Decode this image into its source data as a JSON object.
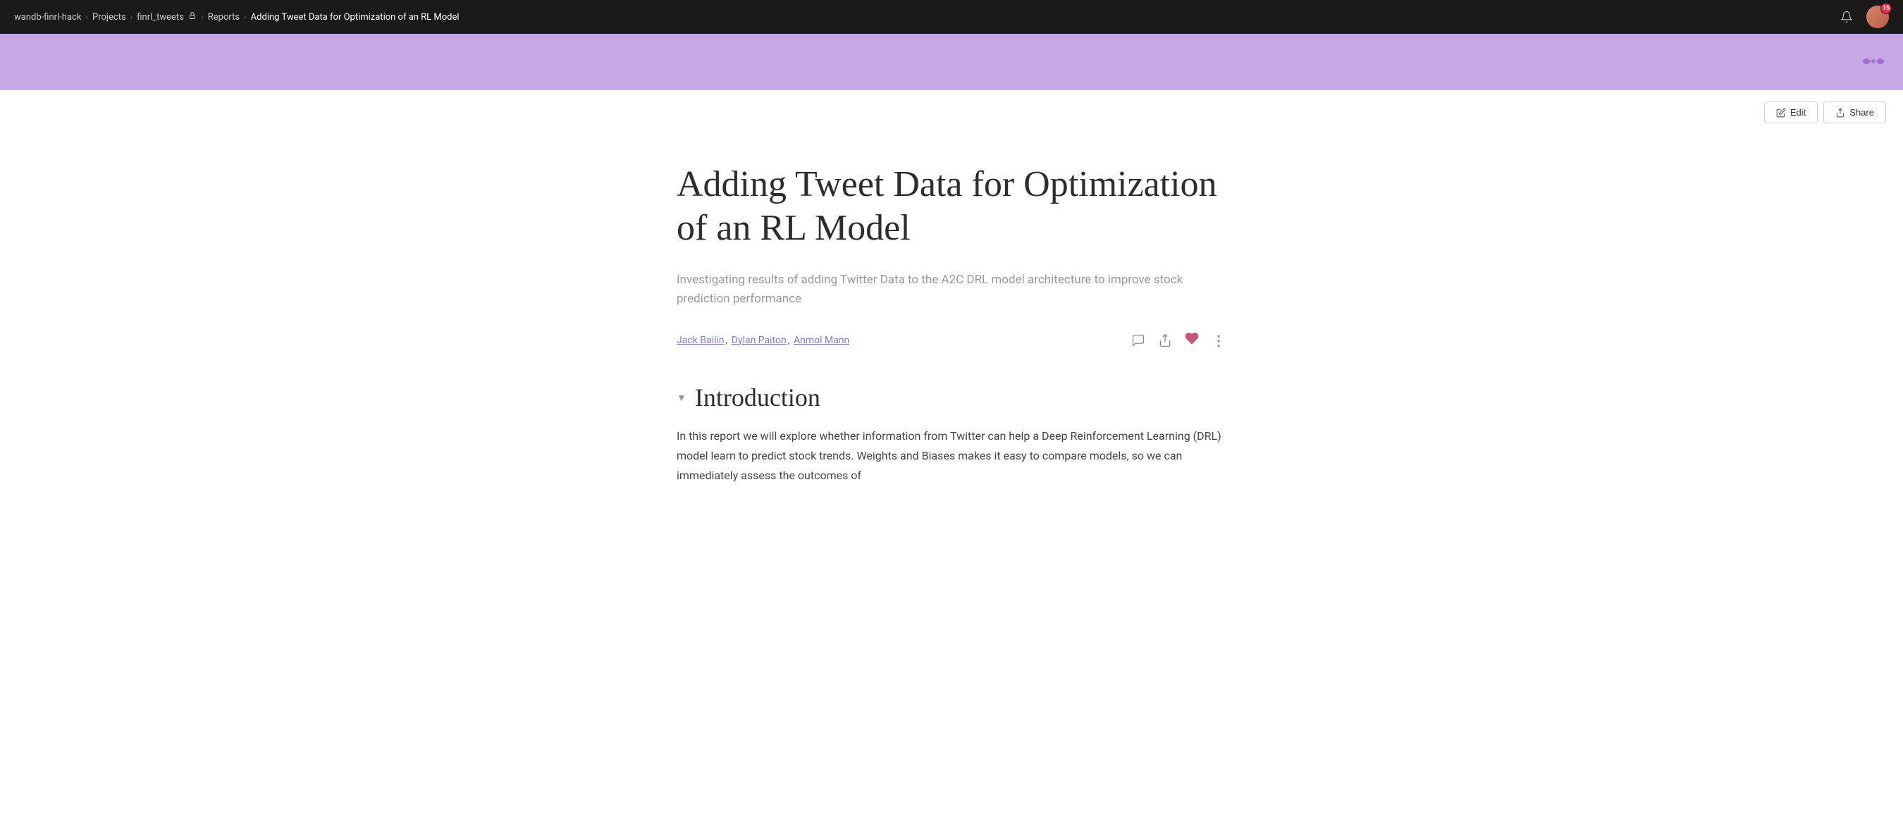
{
  "topbar": {
    "breadcrumbs": [
      {
        "label": "wandb-finrl-hack",
        "id": "bc-org"
      },
      {
        "label": "Projects",
        "id": "bc-projects"
      },
      {
        "label": "finrl_tweets",
        "id": "bc-project",
        "hasLock": true
      },
      {
        "label": "Reports",
        "id": "bc-reports"
      },
      {
        "label": "Adding Tweet Data for Optimization of an RL Model",
        "id": "bc-current",
        "isLast": true
      }
    ],
    "notification_count": "15"
  },
  "action_bar": {
    "edit_label": "Edit",
    "share_label": "Share"
  },
  "report": {
    "title": "Adding Tweet Data for Optimization of an RL Model",
    "subtitle": "Investigating results of adding Twitter Data to the A2C DRL model architecture to improve stock prediction performance",
    "authors": [
      {
        "name": "Jack Bailin",
        "id": "author-jack"
      },
      {
        "name": "Dylan Paiton",
        "id": "author-dylan"
      },
      {
        "name": "Anmol Mann",
        "id": "author-anmol"
      }
    ],
    "sections": [
      {
        "id": "section-introduction",
        "title": "Introduction",
        "body": "In this report we will explore whether information from Twitter can help a Deep Reinforcement Learning (DRL) model learn to predict stock trends. Weights and Biases makes it easy to compare models, so we can immediately assess the outcomes of"
      }
    ]
  },
  "icons": {
    "bell": "bell-icon",
    "edit_pencil": "edit-pencil-icon",
    "share_upload": "share-upload-icon",
    "comment": "comment-icon",
    "share_action": "share-action-icon",
    "heart": "heart-icon",
    "more": "more-icon",
    "collapse": "collapse-icon",
    "bow": "bow-icon",
    "lock": "lock-icon"
  }
}
